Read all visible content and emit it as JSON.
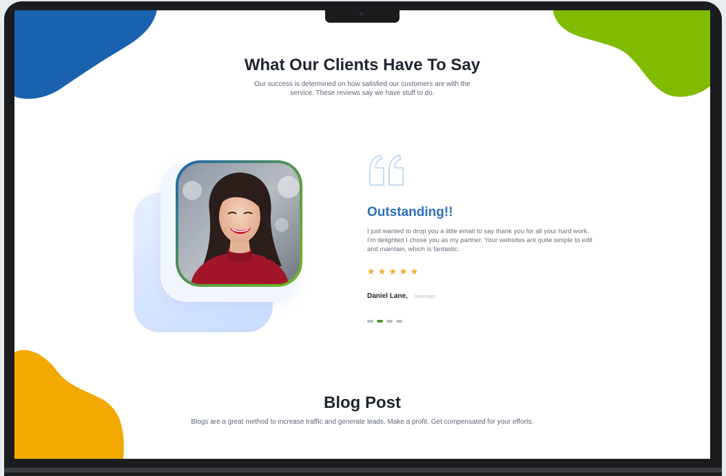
{
  "testimonials": {
    "heading": "What Our Clients Have To Say",
    "subtitle": "Our success is determined on how satisfied our customers are with the service. These reviews say we have stuff to do.",
    "active": {
      "title": "Outstanding!!",
      "body": "I just wanted to drop you a little email to say thank you for all your hard work. I'm delighted I chose you as my partner. Your websites are quite simple to edit and maintain, which is fantastic.",
      "rating": 5,
      "author_name": "Daniel Lane,",
      "author_role": "Developer"
    },
    "slides_total": 4,
    "active_slide": 2
  },
  "blog": {
    "heading": "Blog Post",
    "subtitle": "Blogs are a great method to increase traffic and generate leads. Make a profit. Get compensated for your efforts."
  },
  "colors": {
    "blob_blue": "#1a62b0",
    "blob_green": "#80bb00",
    "blob_orange": "#f2a900",
    "accent_blue": "#2e6fba",
    "accent_green": "#4a9a36",
    "star": "#f5a623"
  },
  "icons": {
    "quote": "quote-icon",
    "star": "star-icon"
  }
}
